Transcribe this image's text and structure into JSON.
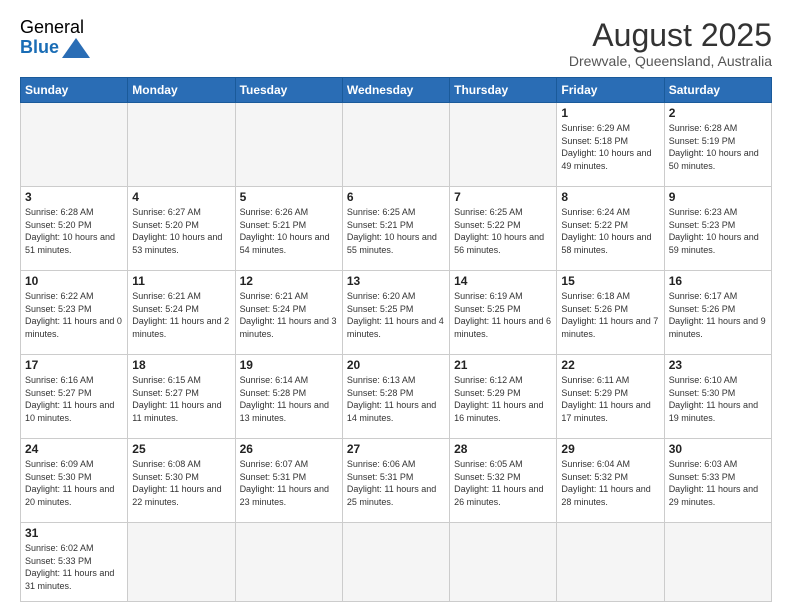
{
  "header": {
    "logo_text_normal": "General",
    "logo_text_blue": "Blue",
    "month_year": "August 2025",
    "location": "Drewvale, Queensland, Australia"
  },
  "weekdays": [
    "Sunday",
    "Monday",
    "Tuesday",
    "Wednesday",
    "Thursday",
    "Friday",
    "Saturday"
  ],
  "weeks": [
    [
      {
        "day": "",
        "info": ""
      },
      {
        "day": "",
        "info": ""
      },
      {
        "day": "",
        "info": ""
      },
      {
        "day": "",
        "info": ""
      },
      {
        "day": "",
        "info": ""
      },
      {
        "day": "1",
        "info": "Sunrise: 6:29 AM\nSunset: 5:18 PM\nDaylight: 10 hours\nand 49 minutes."
      },
      {
        "day": "2",
        "info": "Sunrise: 6:28 AM\nSunset: 5:19 PM\nDaylight: 10 hours\nand 50 minutes."
      }
    ],
    [
      {
        "day": "3",
        "info": "Sunrise: 6:28 AM\nSunset: 5:20 PM\nDaylight: 10 hours\nand 51 minutes."
      },
      {
        "day": "4",
        "info": "Sunrise: 6:27 AM\nSunset: 5:20 PM\nDaylight: 10 hours\nand 53 minutes."
      },
      {
        "day": "5",
        "info": "Sunrise: 6:26 AM\nSunset: 5:21 PM\nDaylight: 10 hours\nand 54 minutes."
      },
      {
        "day": "6",
        "info": "Sunrise: 6:25 AM\nSunset: 5:21 PM\nDaylight: 10 hours\nand 55 minutes."
      },
      {
        "day": "7",
        "info": "Sunrise: 6:25 AM\nSunset: 5:22 PM\nDaylight: 10 hours\nand 56 minutes."
      },
      {
        "day": "8",
        "info": "Sunrise: 6:24 AM\nSunset: 5:22 PM\nDaylight: 10 hours\nand 58 minutes."
      },
      {
        "day": "9",
        "info": "Sunrise: 6:23 AM\nSunset: 5:23 PM\nDaylight: 10 hours\nand 59 minutes."
      }
    ],
    [
      {
        "day": "10",
        "info": "Sunrise: 6:22 AM\nSunset: 5:23 PM\nDaylight: 11 hours\nand 0 minutes."
      },
      {
        "day": "11",
        "info": "Sunrise: 6:21 AM\nSunset: 5:24 PM\nDaylight: 11 hours\nand 2 minutes."
      },
      {
        "day": "12",
        "info": "Sunrise: 6:21 AM\nSunset: 5:24 PM\nDaylight: 11 hours\nand 3 minutes."
      },
      {
        "day": "13",
        "info": "Sunrise: 6:20 AM\nSunset: 5:25 PM\nDaylight: 11 hours\nand 4 minutes."
      },
      {
        "day": "14",
        "info": "Sunrise: 6:19 AM\nSunset: 5:25 PM\nDaylight: 11 hours\nand 6 minutes."
      },
      {
        "day": "15",
        "info": "Sunrise: 6:18 AM\nSunset: 5:26 PM\nDaylight: 11 hours\nand 7 minutes."
      },
      {
        "day": "16",
        "info": "Sunrise: 6:17 AM\nSunset: 5:26 PM\nDaylight: 11 hours\nand 9 minutes."
      }
    ],
    [
      {
        "day": "17",
        "info": "Sunrise: 6:16 AM\nSunset: 5:27 PM\nDaylight: 11 hours\nand 10 minutes."
      },
      {
        "day": "18",
        "info": "Sunrise: 6:15 AM\nSunset: 5:27 PM\nDaylight: 11 hours\nand 11 minutes."
      },
      {
        "day": "19",
        "info": "Sunrise: 6:14 AM\nSunset: 5:28 PM\nDaylight: 11 hours\nand 13 minutes."
      },
      {
        "day": "20",
        "info": "Sunrise: 6:13 AM\nSunset: 5:28 PM\nDaylight: 11 hours\nand 14 minutes."
      },
      {
        "day": "21",
        "info": "Sunrise: 6:12 AM\nSunset: 5:29 PM\nDaylight: 11 hours\nand 16 minutes."
      },
      {
        "day": "22",
        "info": "Sunrise: 6:11 AM\nSunset: 5:29 PM\nDaylight: 11 hours\nand 17 minutes."
      },
      {
        "day": "23",
        "info": "Sunrise: 6:10 AM\nSunset: 5:30 PM\nDaylight: 11 hours\nand 19 minutes."
      }
    ],
    [
      {
        "day": "24",
        "info": "Sunrise: 6:09 AM\nSunset: 5:30 PM\nDaylight: 11 hours\nand 20 minutes."
      },
      {
        "day": "25",
        "info": "Sunrise: 6:08 AM\nSunset: 5:30 PM\nDaylight: 11 hours\nand 22 minutes."
      },
      {
        "day": "26",
        "info": "Sunrise: 6:07 AM\nSunset: 5:31 PM\nDaylight: 11 hours\nand 23 minutes."
      },
      {
        "day": "27",
        "info": "Sunrise: 6:06 AM\nSunset: 5:31 PM\nDaylight: 11 hours\nand 25 minutes."
      },
      {
        "day": "28",
        "info": "Sunrise: 6:05 AM\nSunset: 5:32 PM\nDaylight: 11 hours\nand 26 minutes."
      },
      {
        "day": "29",
        "info": "Sunrise: 6:04 AM\nSunset: 5:32 PM\nDaylight: 11 hours\nand 28 minutes."
      },
      {
        "day": "30",
        "info": "Sunrise: 6:03 AM\nSunset: 5:33 PM\nDaylight: 11 hours\nand 29 minutes."
      }
    ],
    [
      {
        "day": "31",
        "info": "Sunrise: 6:02 AM\nSunset: 5:33 PM\nDaylight: 11 hours\nand 31 minutes."
      },
      {
        "day": "",
        "info": ""
      },
      {
        "day": "",
        "info": ""
      },
      {
        "day": "",
        "info": ""
      },
      {
        "day": "",
        "info": ""
      },
      {
        "day": "",
        "info": ""
      },
      {
        "day": "",
        "info": ""
      }
    ]
  ]
}
